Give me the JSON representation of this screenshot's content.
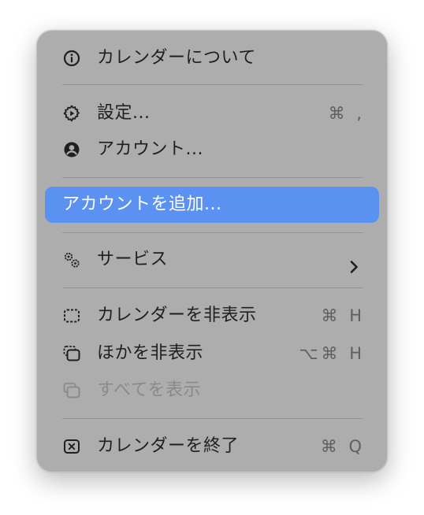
{
  "menu": {
    "about": {
      "label": "カレンダーについて",
      "icon": "info-circle-icon"
    },
    "settings": {
      "label": "設定...",
      "shortcut": "⌘ ,",
      "icon": "gear-icon"
    },
    "accounts": {
      "label": "アカウント...",
      "icon": "user-circle-icon"
    },
    "add_account": {
      "label": "アカウントを追加..."
    },
    "services": {
      "label": "サービス",
      "icon": "gears-icon",
      "submenu_icon": "chevron-right-icon"
    },
    "hide_calendar": {
      "label": "カレンダーを非表示",
      "shortcut": "⌘ H",
      "icon": "dashed-window-icon"
    },
    "hide_others": {
      "label": "ほかを非表示",
      "shortcut": "⌥⌘ H",
      "icon": "stacked-windows-icon"
    },
    "show_all": {
      "label": "すべてを表示",
      "icon": "stacked-windows-icon",
      "disabled": true
    },
    "quit": {
      "label": "カレンダーを終了",
      "shortcut": "⌘ Q",
      "icon": "x-square-icon"
    }
  },
  "colors": {
    "menu_background": "#adadad",
    "highlight": "#5b91f0",
    "text": "#1f1f1f",
    "shortcut_text": "#5f5f5f",
    "disabled_text": "#8a8a8a"
  }
}
